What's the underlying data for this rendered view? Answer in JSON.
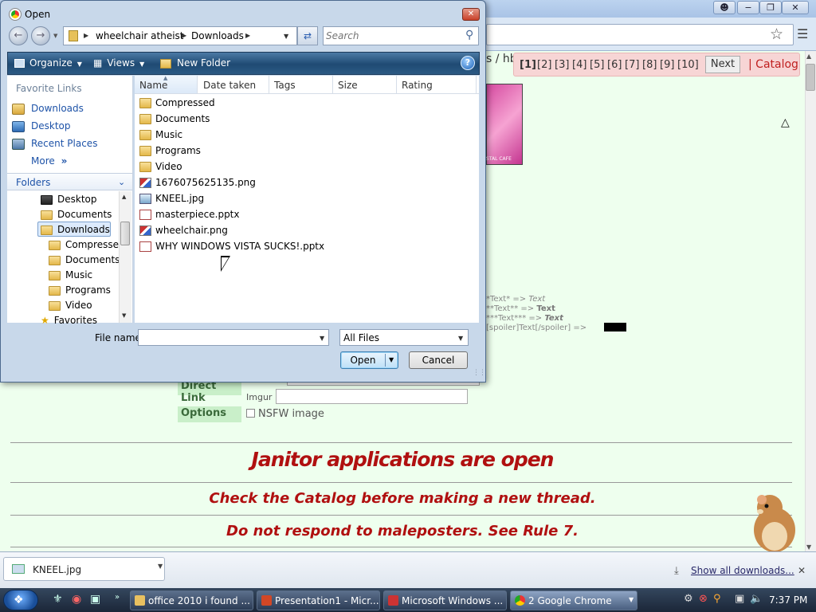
{
  "browser": {
    "window_buttons": [
      "−",
      "❐",
      "✕"
    ],
    "page": {
      "breadcrumb_fragment": "s / hb",
      "pager": {
        "pages": [
          "[1]",
          "[2]",
          "[3]",
          "[4]",
          "[5]",
          "[6]",
          "[7]",
          "[8]",
          "[9]",
          "[10]"
        ],
        "next_label": "Next",
        "catalog_label": "| Catalog"
      },
      "thumbnail_caption": "STAL CAFE",
      "formatting_help": [
        {
          "input": "*Text* =>",
          "output": "Text"
        },
        {
          "input": "**Text** =>",
          "output": "Text"
        },
        {
          "input": "***Text*** =>",
          "output": "Text"
        },
        {
          "input": "[spoiler]Text[/spoiler] =>",
          "output": ""
        }
      ],
      "form": {
        "direct_link_label": "Direct Link",
        "imgur_label": "Imgur",
        "imgur_value": "",
        "options_label": "Options",
        "nsfw_label": "NSFW image"
      },
      "banners": [
        "Janitor applications are open",
        "Check the Catalog before making a new thread.",
        "Do not respond to maleposters. See Rule 7."
      ]
    },
    "download_shelf": {
      "item": "KNEEL.jpg",
      "show_all": "Show all downloads..."
    }
  },
  "dialog": {
    "title": "Open",
    "address": {
      "segments": [
        "wheelchair atheist",
        "Downloads"
      ]
    },
    "search_placeholder": "Search",
    "toolbar": {
      "organize": "Organize",
      "views": "Views",
      "new_folder": "New Folder"
    },
    "favorites_header": "Favorite Links",
    "favorites": [
      "Downloads",
      "Desktop",
      "Recent Places"
    ],
    "more_label": "More",
    "folders_label": "Folders",
    "tree": [
      "Desktop",
      "Documents",
      "Downloads",
      "Compressed",
      "Documents",
      "Music",
      "Programs",
      "Video",
      "Favorites"
    ],
    "columns": [
      "Name",
      "Date taken",
      "Tags",
      "Size",
      "Rating"
    ],
    "files": [
      {
        "name": "Compressed",
        "type": "folder"
      },
      {
        "name": "Documents",
        "type": "folder"
      },
      {
        "name": "Music",
        "type": "folder"
      },
      {
        "name": "Programs",
        "type": "folder"
      },
      {
        "name": "Video",
        "type": "folder"
      },
      {
        "name": "1676075625135.png",
        "type": "png"
      },
      {
        "name": "KNEEL.jpg",
        "type": "jpg"
      },
      {
        "name": "masterpiece.pptx",
        "type": "pptx"
      },
      {
        "name": "wheelchair.png",
        "type": "png"
      },
      {
        "name": "WHY WINDOWS VISTA SUCKS!.pptx",
        "type": "pptx"
      }
    ],
    "file_name_label": "File name:",
    "file_name_value": "",
    "filter_value": "All Files",
    "open_label": "Open",
    "cancel_label": "Cancel"
  },
  "taskbar": {
    "tasks": [
      "office 2010 i found ...",
      "Presentation1 - Micr...",
      "Microsoft Windows ...",
      "2 Google Chrome"
    ],
    "clock": "7:37 PM"
  },
  "colors": {
    "page_bg": "#eeffee",
    "banner_red": "#b01010",
    "link_blue": "#1e53a8",
    "pager_bg": "#f7d5d5"
  }
}
